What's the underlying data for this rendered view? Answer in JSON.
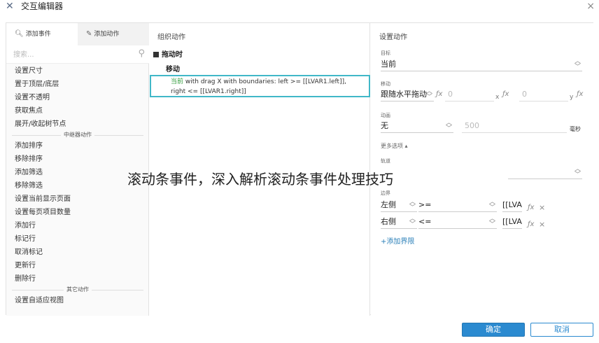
{
  "window": {
    "title": "交互编辑器",
    "icon": "axure-x-icon",
    "close": "×"
  },
  "left": {
    "tabs": [
      {
        "label": "添加事件",
        "icon": "magnifier-icon"
      },
      {
        "label": "添加动作",
        "icon": "wrench-icon"
      }
    ],
    "search_placeholder": "搜索...",
    "items_top": [
      "设置尺寸",
      "置于顶层/底层",
      "设置不透明",
      "获取焦点",
      "展开/收起树节点"
    ],
    "section_repeater": "中继器动作",
    "items_repeater": [
      "添加排序",
      "移除排序",
      "添加筛选",
      "移除筛选",
      "设置当前显示页面",
      "设置每页项目数量",
      "添加行",
      "标记行",
      "取消标记",
      "更新行",
      "删除行"
    ],
    "section_other": "其它动作",
    "items_other": [
      "设置自适应视图"
    ]
  },
  "middle": {
    "title": "组织动作",
    "event": "拖动时",
    "case": "移动",
    "action_prefix": "当前",
    "action_line1": " with drag X  with boundaries: left >= [[LVAR1.left]],",
    "action_line2": "right <= [[LVAR1.right]]"
  },
  "right": {
    "title": "设置动作",
    "target_label": "目标",
    "target_value": "当前",
    "move_label": "移动",
    "move_value": "跟随水平拖动",
    "x_value": "0",
    "x_unit": "x",
    "y_value": "0",
    "y_unit": "y",
    "anim_label": "动画",
    "anim_value": "无",
    "duration": "500",
    "duration_unit": "毫秒",
    "more_options": "更多选项 ▴",
    "track_label": "轨道",
    "bounds_label": "边界",
    "bound1_side": "左侧",
    "bound1_op": ">=",
    "bound1_value": "[[LVA",
    "bound2_side": "右侧",
    "bound2_op": "<=",
    "bound2_value": "[[LVA",
    "add_bound": "+添加界限"
  },
  "buttons": {
    "ok": "确定",
    "cancel": "取消"
  },
  "overlay_text": "滚动条事件，深入解析滚动条事件处理技巧",
  "colors": {
    "accent": "#2b8ad0",
    "highlight_border": "#41b8c8",
    "target_green": "#3aa043"
  }
}
